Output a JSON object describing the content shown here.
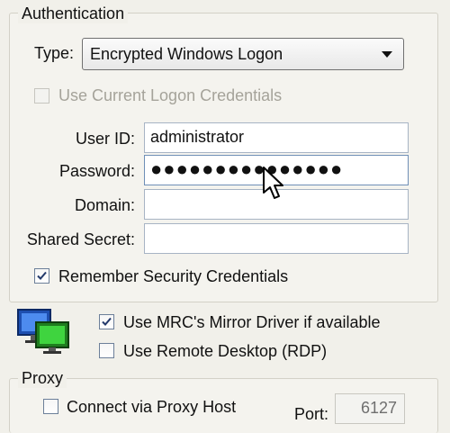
{
  "authentication": {
    "legend": "Authentication",
    "type_label": "Type:",
    "type_value": "Encrypted Windows Logon",
    "use_current_label": "Use Current Logon Credentials",
    "user_id_label": "User ID:",
    "user_id_value": "administrator",
    "password_label": "Password:",
    "password_value": "●●●●●●●●●●●●●●●",
    "domain_label": "Domain:",
    "domain_value": "",
    "shared_secret_label": "Shared Secret:",
    "shared_secret_value": "",
    "remember_label": "Remember Security Credentials",
    "remember_checked": true,
    "use_current_checked": false
  },
  "options": {
    "mirror_driver_label": "Use MRC's Mirror Driver if available",
    "mirror_driver_checked": true,
    "rdp_label": "Use Remote Desktop (RDP)",
    "rdp_checked": false
  },
  "proxy": {
    "legend": "Proxy",
    "connect_label": "Connect via Proxy Host",
    "connect_checked": false,
    "port_label": "Port:",
    "port_value": "6127"
  },
  "icons": {
    "computers": "two-monitors-icon",
    "cursor": "mouse-pointer-icon"
  }
}
